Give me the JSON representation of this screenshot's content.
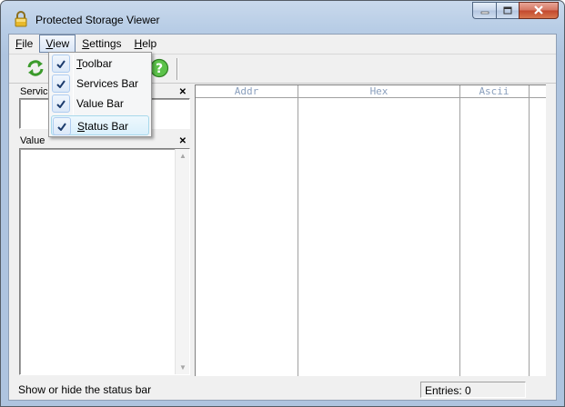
{
  "window": {
    "title": "Protected Storage Viewer"
  },
  "menubar": {
    "items": [
      {
        "label_pre": "",
        "label_ul": "F",
        "label_post": "ile"
      },
      {
        "label_pre": "",
        "label_ul": "V",
        "label_post": "iew"
      },
      {
        "label_pre": "",
        "label_ul": "S",
        "label_post": "ettings"
      },
      {
        "label_pre": "",
        "label_ul": "H",
        "label_post": "elp"
      }
    ]
  },
  "toolbar": {
    "buttons": [
      {
        "icon": "refresh-icon"
      },
      {
        "icon": "help-icon"
      }
    ]
  },
  "services_panel": {
    "title": "Servic"
  },
  "value_panel": {
    "title": "Value"
  },
  "hex_view": {
    "columns": [
      "Addr",
      "Hex",
      "Ascii"
    ]
  },
  "view_menu": {
    "items": [
      {
        "ul": "T",
        "rest": "oolbar",
        "checked": true
      },
      {
        "ul": "",
        "rest": "Services Bar",
        "checked": true
      },
      {
        "ul": "",
        "rest": "Value Bar",
        "checked": true
      },
      {
        "ul": "S",
        "rest": "tatus Bar",
        "checked": true
      }
    ]
  },
  "statusbar": {
    "message": "Show or hide the status bar",
    "entries": "Entries: 0"
  },
  "colors": {
    "refresh": "#3a9a2a",
    "help": "#3aa83a",
    "hex_header": "#8a9fbd"
  }
}
